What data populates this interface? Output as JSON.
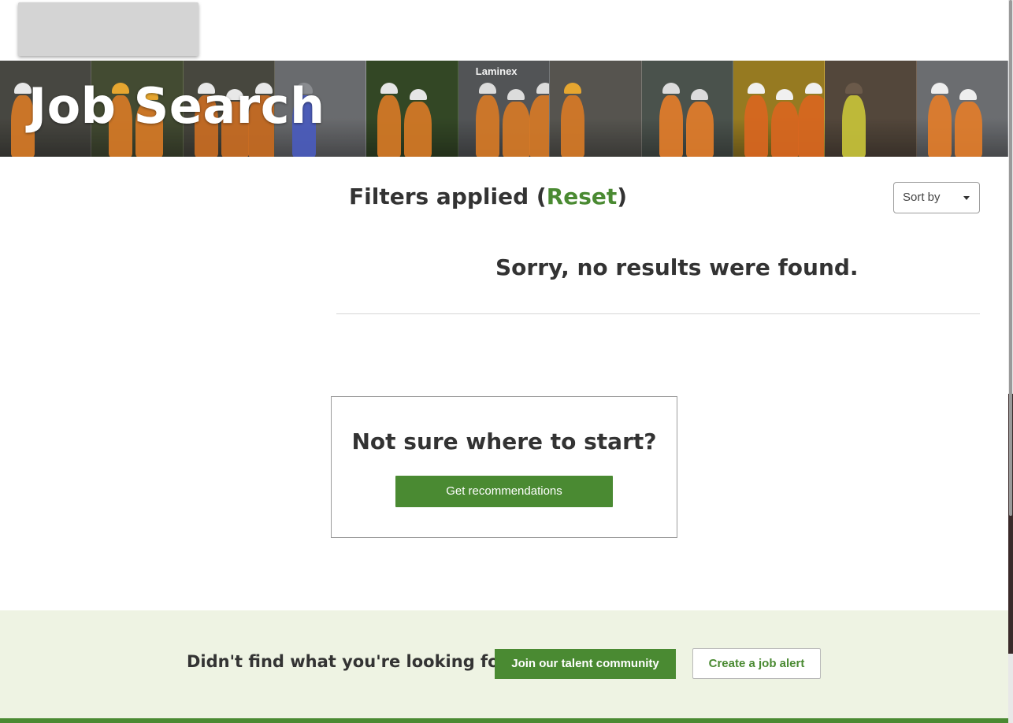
{
  "header": {
    "logo_icon": "company-logo"
  },
  "hero": {
    "title": "Job Search",
    "tiles": [
      {
        "bg": "#5b5a52",
        "vest": "#d67a26",
        "helmet": "#e8e8e8"
      },
      {
        "bg": "#55603e",
        "vest": "#d67a26",
        "helmet": "#e6a630"
      },
      {
        "bg": "#5b5a4e",
        "vest": "#c96d23",
        "helmet": "#e8e8e8"
      },
      {
        "bg": "#8a8c90",
        "vest": "#4a5bbd",
        "helmet": "#8a8c90"
      },
      {
        "bg": "#3f5a2c",
        "vest": "#d67a26",
        "helmet": "#e6e6e6"
      },
      {
        "bg": "#6a6d70",
        "vest": "#d67a26",
        "helmet": "#dcdcdc"
      },
      {
        "bg": "#6f6d66",
        "vest": "#d67a26",
        "helmet": "#e6a630"
      },
      {
        "bg": "#5f6a62",
        "vest": "#e27d2a",
        "helmet": "#dcdcdc"
      },
      {
        "bg": "#c8a126",
        "vest": "#d8661f",
        "helmet": "#f0f0f0"
      },
      {
        "bg": "#6b5a4a",
        "vest": "#c8c33a",
        "helmet": "#6b5a4a"
      },
      {
        "bg": "#8c8f94",
        "vest": "#e27d2a",
        "helmet": "#eeeeee"
      }
    ],
    "brand_sign": "Laminex"
  },
  "results": {
    "filters_prefix": "Filters applied (",
    "reset_label": "Reset",
    "filters_suffix": ")",
    "sort_label": "Sort by",
    "no_results": "Sorry, no results were found."
  },
  "recommend": {
    "title": "Not sure where to start?",
    "button": "Get recommendations"
  },
  "band": {
    "question": "Didn't find what you're looking for?",
    "join_button": "Join our talent community",
    "alert_button": "Create a job alert"
  },
  "colors": {
    "accent": "#4a8a32",
    "band_bg": "#eef3e3",
    "text": "#333333"
  }
}
